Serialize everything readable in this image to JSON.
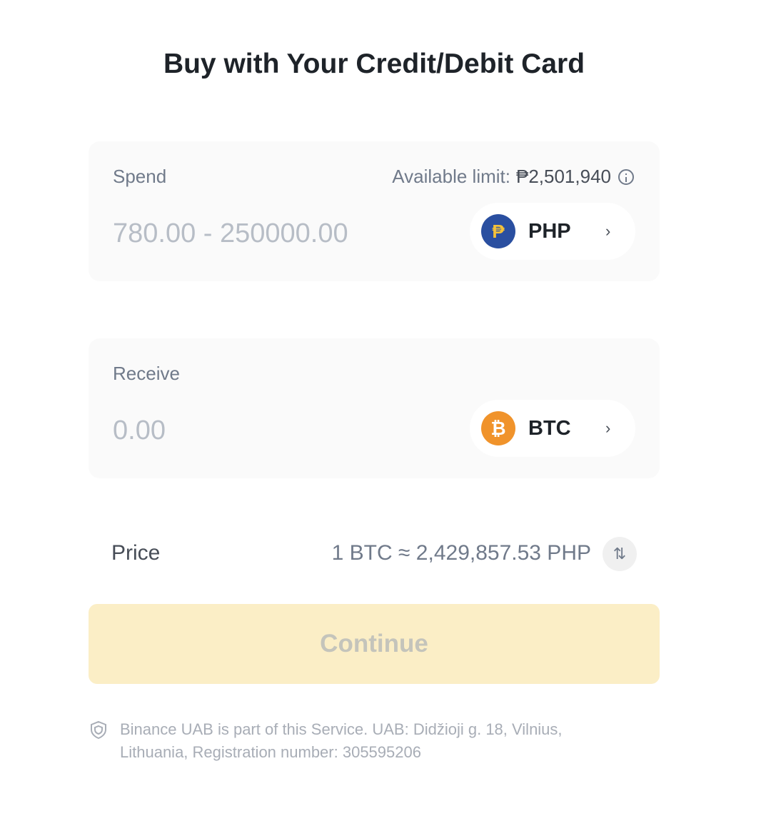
{
  "title": "Buy with Your Credit/Debit Card",
  "spend": {
    "label": "Spend",
    "available_limit_label": "Available limit:",
    "available_limit_value": "₱2,501,940",
    "amount_placeholder": "780.00 - 250000.00",
    "currency": {
      "code": "PHP",
      "icon": "peso-coin-icon",
      "glyph": "₱",
      "color": "#2a4fa0"
    }
  },
  "receive": {
    "label": "Receive",
    "amount_placeholder": "0.00",
    "currency": {
      "code": "BTC",
      "icon": "bitcoin-coin-icon",
      "glyph": "₿",
      "color": "#f0932b"
    }
  },
  "price": {
    "label": "Price",
    "value": "1 BTC ≈ 2,429,857.53 PHP"
  },
  "continue_label": "Continue",
  "footer": {
    "text": "Binance UAB is part of this Service. UAB: Didžioji g. 18, Vilnius, Lithuania, Registration number: 305595206"
  },
  "colors": {
    "accent_disabled": "#fbeec6",
    "text_primary": "#1e2329",
    "text_secondary": "#707a8a"
  }
}
